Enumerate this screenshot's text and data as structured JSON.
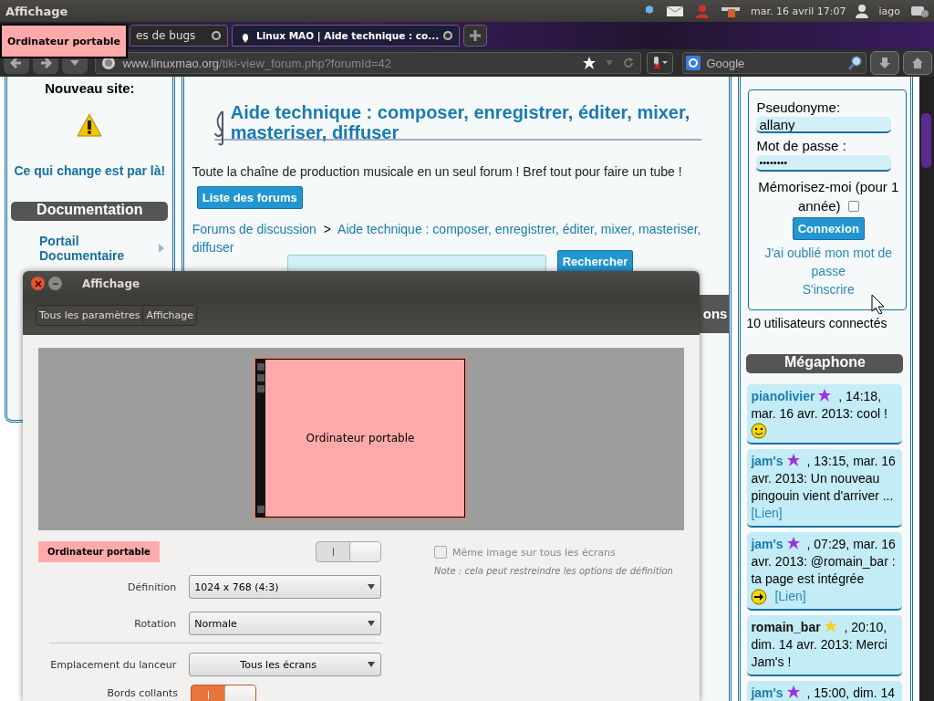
{
  "top_panel": {
    "app_title": "Affichage",
    "clock": "mar. 16 avril 17:07",
    "user": "iago"
  },
  "browser": {
    "tabs": [
      {
        "label": "es de bugs",
        "selected": false
      },
      {
        "label": "Linux MAO | Aide technique : co...",
        "selected": true
      }
    ],
    "url": {
      "domain": "www.linuxmao.org",
      "path": "/tiki-view_forum.php?forumId=42"
    },
    "search": {
      "placeholder": "Google"
    }
  },
  "display_tag": "Ordinateur portable",
  "page": {
    "left": {
      "new_site": "Nouveau site:",
      "change_link": "Ce qui change est par là!",
      "doc_heading": "Documentation",
      "doc_items": [
        "Portail Documentaire"
      ]
    },
    "center": {
      "title": "Aide technique : composer, enregistrer, éditer, mixer, masteriser, diffuser",
      "description": "Toute la chaîne de production musicale en un seul forum ! Bref tout pour faire un tube !",
      "forum_list_button": "Liste des forums",
      "breadcrumb": [
        "Forums de discussion",
        "Aide technique : composer, enregistrer, éditer, mixer, masteriser, diffuser"
      ],
      "breadcrumb_separator": ">",
      "search_button": "Rechercher",
      "heading_tail": "ons"
    },
    "right": {
      "login": {
        "user_label": "Pseudonyme:",
        "user_value": "allany",
        "password_label": "Mot de passe :",
        "password_value": "••••••••",
        "remember_label_lines": [
          "Mémorisez-moi (pour 1",
          "année)"
        ],
        "remember_checked": false,
        "submit": "Connexion",
        "forgot_link": "J'ai oublié mon mot de passe",
        "register_link": "S'inscrire"
      },
      "online_users": "10 utilisateurs connectés",
      "megaphone_heading": "Mégaphone",
      "posts": [
        {
          "kind": "smiley",
          "author": "pianolivier",
          "author_link": true,
          "color": "#9933dd",
          "text": ", 14:18, mar. 16 avr. 2013: cool !"
        },
        {
          "kind": "plain",
          "author": "jam's",
          "author_link": true,
          "color": "#9933dd",
          "text": ", 13:15, mar. 16 avr. 2013: Un nouveau pingouin vient d'arriver ...",
          "link": "[Lien]"
        },
        {
          "kind": "arrow",
          "author": "jam's",
          "author_link": true,
          "color": "#9933dd",
          "text": ", 07:29, mar. 16 avr. 2013: @romain_bar : ta page est intégrée",
          "link": "[Lien]"
        },
        {
          "kind": "plain",
          "author": "romain_bar",
          "author_link": false,
          "color": "#f5d020",
          "text": ", 20:10, dim. 14 avr. 2013: Merci Jam's !"
        },
        {
          "kind": "plain",
          "author": "jam's",
          "author_link": true,
          "color": "#9933dd",
          "text": ", 15:00, dim. 14"
        }
      ]
    }
  },
  "dialog": {
    "title": "Affichage",
    "breadcrumbs": [
      "Tous les paramètres",
      "Affichage"
    ],
    "monitor": {
      "label": "Ordinateur portable"
    },
    "display_name": "Ordinateur portable",
    "display_switch": {
      "on": true,
      "disabled": true
    },
    "mirror": {
      "label": "Même image sur tous les écrans",
      "checked": false,
      "disabled": true
    },
    "note": "Note : cela peut restreindre les options de définition",
    "display_settings": [
      {
        "label": "Définition",
        "value": "1024 x 768 (4:3)"
      },
      {
        "label": "Rotation",
        "value": "Normale"
      }
    ],
    "launcher_setting": {
      "label": "Emplacement du lanceur",
      "value": "Tous les écrans"
    },
    "sticky_edges": {
      "label": "Bords collants",
      "on": true,
      "disabled": false
    }
  }
}
